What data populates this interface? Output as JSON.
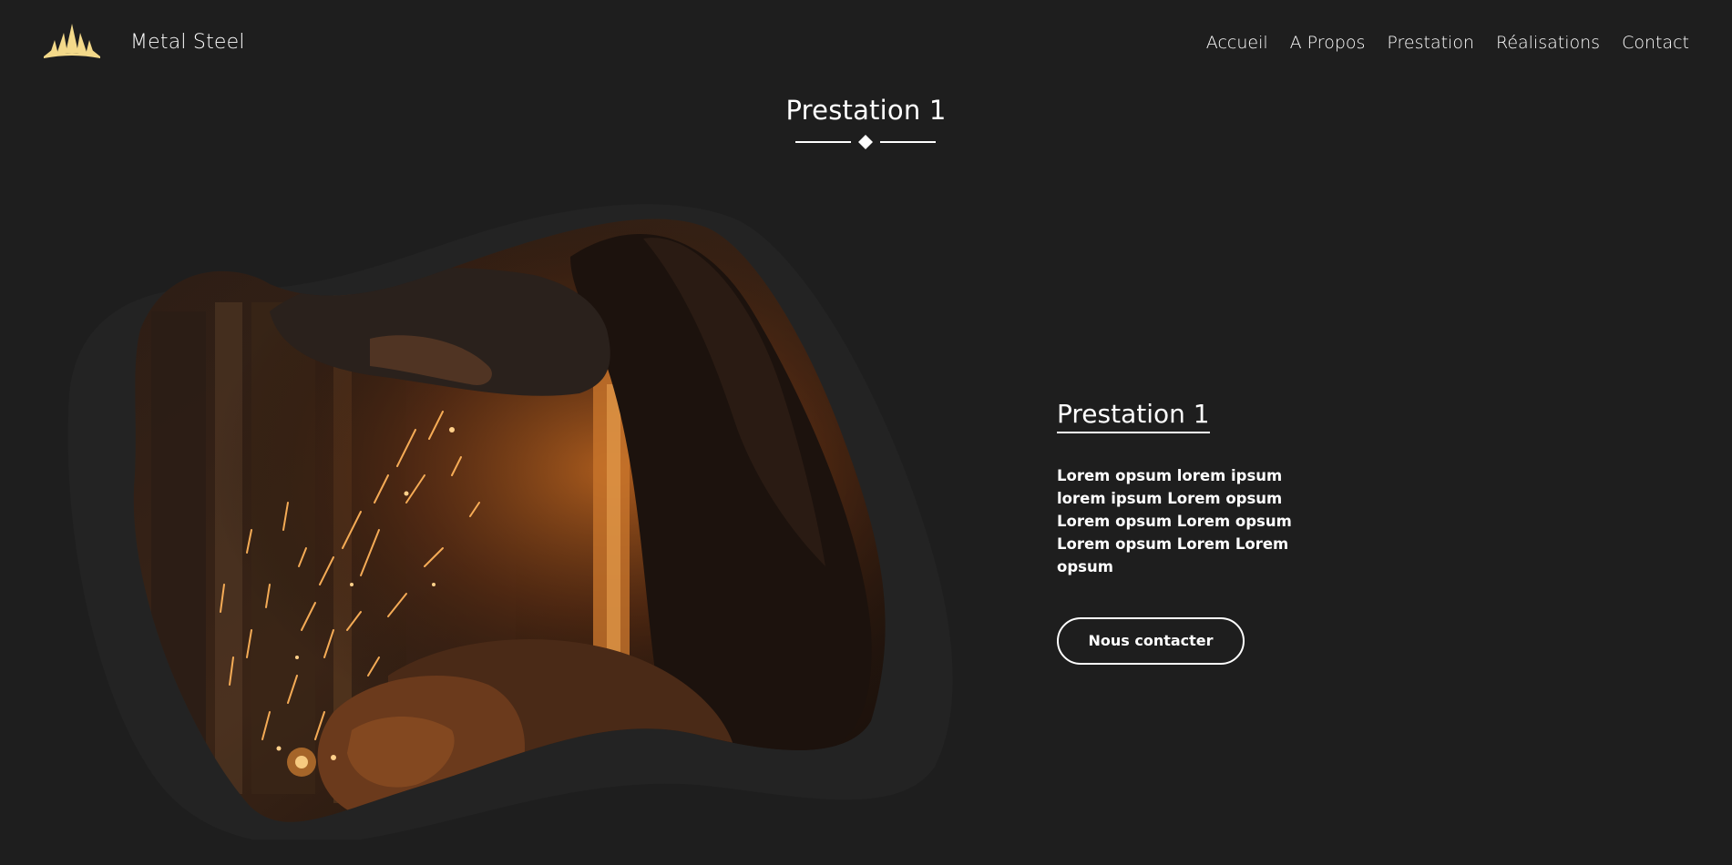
{
  "header": {
    "brand": "Metal Steel",
    "logo_icon": "sun-crown-icon",
    "accent": "#f3d98a",
    "nav": [
      {
        "label": "Accueil"
      },
      {
        "label": "A Propos"
      },
      {
        "label": "Prestation"
      },
      {
        "label": "Réalisations"
      },
      {
        "label": "Contact"
      }
    ]
  },
  "section": {
    "title": "Prestation 1",
    "divider_icon": "diamond-icon"
  },
  "content": {
    "title": "Prestation 1",
    "text": "Lorem opsum lorem ipsum lorem ipsum Lorem opsum Lorem opsum Lorem opsum Lorem opsum Lorem Lorem opsum",
    "button_label": "Nous contacter"
  },
  "colors": {
    "background": "#1e1e1e",
    "blob_outer": "#232323",
    "text": "#ffffff"
  }
}
